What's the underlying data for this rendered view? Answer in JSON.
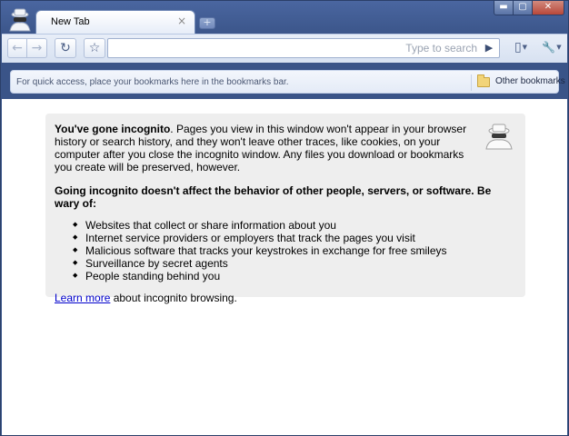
{
  "window": {
    "controls": {
      "minimize": "▬",
      "maximize": "▢",
      "close": "✕"
    }
  },
  "tabs": [
    {
      "label": "New Tab",
      "close_glyph": "×"
    }
  ],
  "new_tab_glyph": "+",
  "toolbar": {
    "back_glyph": "←",
    "forward_glyph": "→",
    "reload_glyph": "↻",
    "star_glyph": "☆",
    "omnibox": {
      "value": "",
      "placeholder": "Type to search",
      "go_glyph": "▶"
    },
    "page_glyph": "▯",
    "wrench_glyph": "🔧",
    "caret": "▼"
  },
  "bookmarks_bar": {
    "hint": "For quick access, place your bookmarks here in the bookmarks bar.",
    "other_label": "Other bookmarks"
  },
  "incognito": {
    "intro_bold": "You've gone incognito",
    "intro_rest": ". Pages you view in this window won't appear in your browser history or search history, and they won't leave other traces, like cookies, on your computer after you close the incognito window. Any files you download or bookmarks you create will be preserved, however.",
    "warning": "Going incognito doesn't affect the behavior of other people, servers, or software. Be wary of:",
    "risks": [
      "Websites that collect or share information about you",
      "Internet service providers or employers that track the pages you visit",
      "Malicious software that tracks your keystrokes in exchange for free smileys",
      "Surveillance by secret agents",
      "People standing behind you"
    ],
    "learn_more_link": "Learn more",
    "learn_more_rest": " about incognito browsing."
  },
  "colors": {
    "frame": "#3a5488",
    "link": "#0000cc",
    "box": "#eeeeee"
  }
}
